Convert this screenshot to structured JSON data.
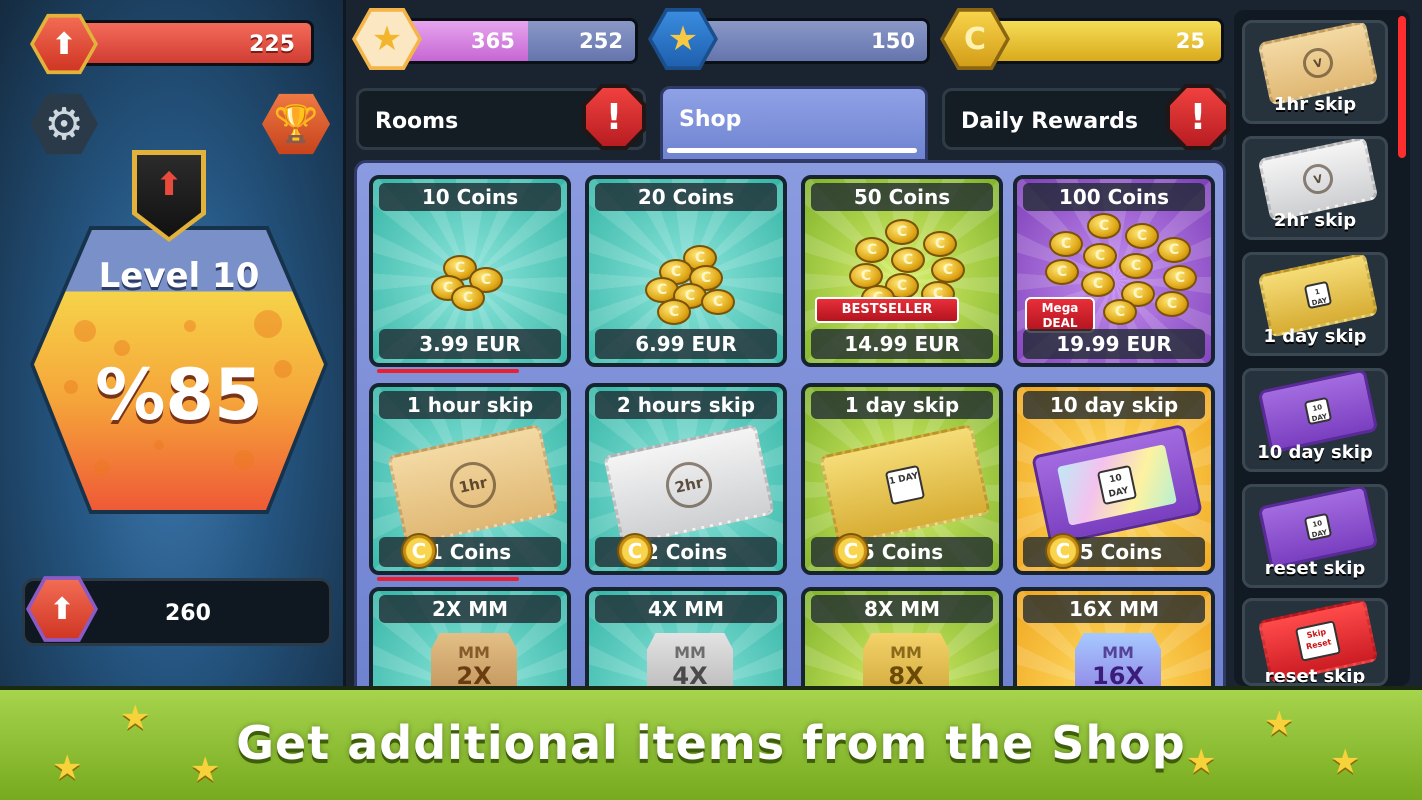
{
  "player": {
    "xp_value": "225",
    "level_label": "Level 10",
    "level_percent": "%85",
    "level_progress": 0.85,
    "energy_value": "260"
  },
  "currencies": {
    "stars_primary": "365",
    "stars_secondary": "252",
    "blue_stars": "150",
    "coins": "25"
  },
  "tabs": {
    "rooms": "Rooms",
    "shop": "Shop",
    "daily_rewards": "Daily Rewards",
    "active": "Shop"
  },
  "shop": {
    "row1": [
      {
        "title": "10 Coins",
        "price": "3.99 EUR"
      },
      {
        "title": "20 Coins",
        "price": "6.99 EUR"
      },
      {
        "title": "50 Coins",
        "price": "14.99 EUR",
        "badge": "BESTSELLER"
      },
      {
        "title": "100 Coins",
        "price": "19.99 EUR",
        "badge": "Mega DEAL"
      }
    ],
    "row2": [
      {
        "title": "1 hour skip",
        "cost": "1 Coins",
        "ticket_text": "1hr"
      },
      {
        "title": "2 hours skip",
        "cost": "2 Coins",
        "ticket_text": "2hr"
      },
      {
        "title": "1 day skip",
        "cost": "5 Coins",
        "ticket_text": "1 DAY"
      },
      {
        "title": "10 day skip",
        "cost": "25 Coins",
        "ticket_text": "10 DAY"
      }
    ],
    "row3": [
      {
        "title": "2X MM",
        "shield_text": "2X"
      },
      {
        "title": "4X MM",
        "shield_text": "4X"
      },
      {
        "title": "8X MM",
        "shield_text": "8X"
      },
      {
        "title": "16X MM",
        "shield_text": "16X"
      }
    ],
    "shield_label": "MM"
  },
  "inventory": [
    {
      "label": "1hr skip"
    },
    {
      "label": "2hr skip"
    },
    {
      "label": "1 day skip"
    },
    {
      "label": "10 day skip"
    },
    {
      "label": "reset skip"
    },
    {
      "label": "reset skip",
      "ticket_text": "Skip Reset"
    }
  ],
  "banner": {
    "text": "Get additional items from the Shop"
  },
  "colors": {
    "xp_bar": "#d03d33",
    "shop_tab": "#7f91dc",
    "banner": "#8fc33a",
    "coin_bar": "#e8c235"
  }
}
